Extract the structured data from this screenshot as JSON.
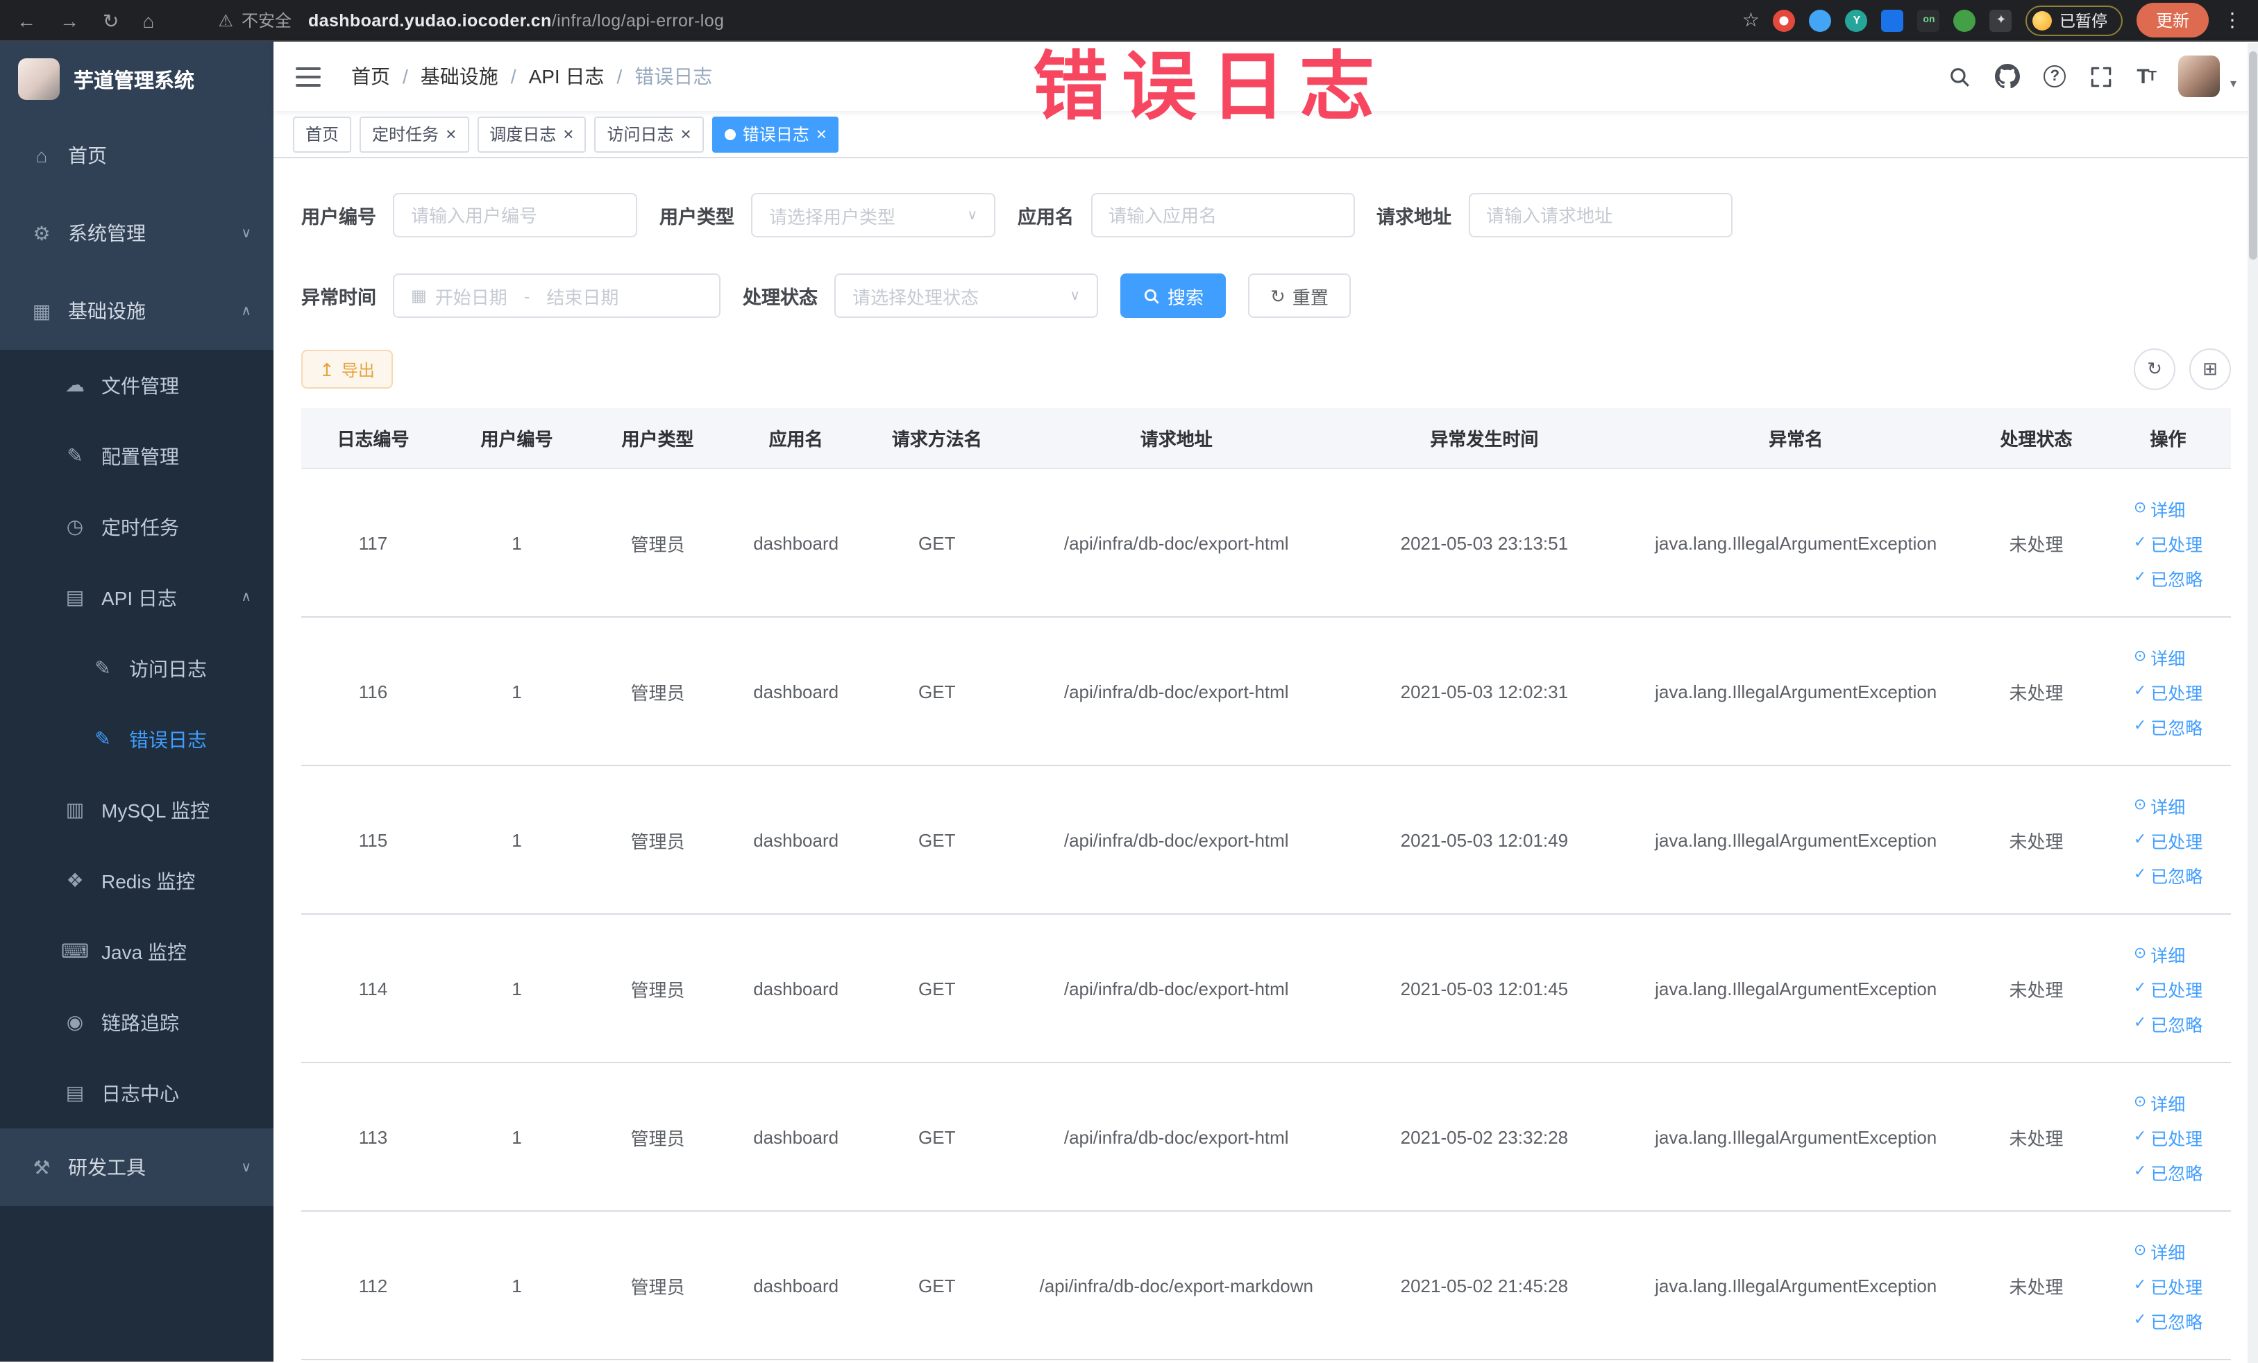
{
  "colors": {
    "accent": "#409eff",
    "sidebar_bg": "#304156",
    "sidebar_submenu_bg": "#1f2d3d",
    "annotation": "#f74760",
    "warning": "#e6a23c"
  },
  "browser": {
    "security_text": "不安全",
    "url_domain": "dashboard.yudao.iocoder.cn",
    "url_path": "/infra/log/api-error-log",
    "paused_badge": "已暂停",
    "update_button": "更新"
  },
  "annotation": {
    "text": "错误日志"
  },
  "sidebar": {
    "logo_title": "芋道管理系统",
    "items": [
      {
        "key": "home",
        "label": "首页",
        "icon": "home-icon",
        "glyph": "⌂",
        "level": 1
      },
      {
        "key": "system-management",
        "label": "系统管理",
        "icon": "gear-icon",
        "glyph": "⚙",
        "level": 1,
        "chevron": "down"
      },
      {
        "key": "infrastructure",
        "label": "基础设施",
        "icon": "grid-icon",
        "glyph": "▦",
        "level": 1,
        "chevron": "up"
      },
      {
        "key": "file-management",
        "label": "文件管理",
        "icon": "cloud-icon",
        "glyph": "☁",
        "level": 2
      },
      {
        "key": "config-management",
        "label": "配置管理",
        "icon": "edit-icon",
        "glyph": "✎",
        "level": 2
      },
      {
        "key": "scheduled-tasks",
        "label": "定时任务",
        "icon": "clock-icon",
        "glyph": "◷",
        "level": 2
      },
      {
        "key": "api-log",
        "label": "API 日志",
        "icon": "document-icon",
        "glyph": "▤",
        "level": 2,
        "chevron": "up"
      },
      {
        "key": "access-log",
        "label": "访问日志",
        "icon": "document-edit-icon",
        "glyph": "✎",
        "level": 3
      },
      {
        "key": "error-log",
        "label": "错误日志",
        "icon": "document-edit-icon",
        "glyph": "✎",
        "level": 3,
        "active": true
      },
      {
        "key": "mysql-monitor",
        "label": "MySQL 监控",
        "icon": "database-icon",
        "glyph": "▥",
        "level": 2
      },
      {
        "key": "redis-monitor",
        "label": "Redis 监控",
        "icon": "storage-icon",
        "glyph": "❖",
        "level": 2
      },
      {
        "key": "java-monitor",
        "label": "Java 监控",
        "icon": "monitor-icon",
        "glyph": "⌨",
        "level": 2
      },
      {
        "key": "link-tracing",
        "label": "链路追踪",
        "icon": "eye-icon",
        "glyph": "◉",
        "level": 2
      },
      {
        "key": "log-center",
        "label": "日志中心",
        "icon": "list-icon",
        "glyph": "▤",
        "level": 2
      },
      {
        "key": "dev-tools",
        "label": "研发工具",
        "icon": "tools-icon",
        "glyph": "⚒",
        "level": 1,
        "chevron": "down"
      }
    ]
  },
  "header": {
    "breadcrumb": [
      "首页",
      "基础设施",
      "API 日志",
      "错误日志"
    ]
  },
  "tabs": [
    {
      "label": "首页",
      "closable": false,
      "active": false
    },
    {
      "label": "定时任务",
      "closable": true,
      "active": false
    },
    {
      "label": "调度日志",
      "closable": true,
      "active": false
    },
    {
      "label": "访问日志",
      "closable": true,
      "active": false
    },
    {
      "label": "错误日志",
      "closable": true,
      "active": true
    }
  ],
  "filters": {
    "user_id_label": "用户编号",
    "user_id_placeholder": "请输入用户编号",
    "user_type_label": "用户类型",
    "user_type_placeholder": "请选择用户类型",
    "app_name_label": "应用名",
    "app_name_placeholder": "请输入应用名",
    "request_url_label": "请求地址",
    "request_url_placeholder": "请输入请求地址",
    "exception_time_label": "异常时间",
    "start_date_placeholder": "开始日期",
    "end_date_placeholder": "结束日期",
    "process_status_label": "处理状态",
    "process_status_placeholder": "请选择处理状态",
    "search_button": "搜索",
    "reset_button": "重置"
  },
  "toolbar": {
    "export_label": "导出"
  },
  "table": {
    "columns": [
      "日志编号",
      "用户编号",
      "用户类型",
      "应用名",
      "请求方法名",
      "请求地址",
      "异常发生时间",
      "异常名",
      "处理状态",
      "操作"
    ],
    "action_labels": {
      "detail": "详细",
      "processed": "已处理",
      "ignored": "已忽略"
    },
    "rows": [
      {
        "id": "117",
        "user_id": "1",
        "user_type": "管理员",
        "app": "dashboard",
        "method": "GET",
        "url": "/api/infra/db-doc/export-html",
        "time": "2021-05-03 23:13:51",
        "exception": "java.lang.IllegalArgumentException",
        "status": "未处理"
      },
      {
        "id": "116",
        "user_id": "1",
        "user_type": "管理员",
        "app": "dashboard",
        "method": "GET",
        "url": "/api/infra/db-doc/export-html",
        "time": "2021-05-03 12:02:31",
        "exception": "java.lang.IllegalArgumentException",
        "status": "未处理"
      },
      {
        "id": "115",
        "user_id": "1",
        "user_type": "管理员",
        "app": "dashboard",
        "method": "GET",
        "url": "/api/infra/db-doc/export-html",
        "time": "2021-05-03 12:01:49",
        "exception": "java.lang.IllegalArgumentException",
        "status": "未处理"
      },
      {
        "id": "114",
        "user_id": "1",
        "user_type": "管理员",
        "app": "dashboard",
        "method": "GET",
        "url": "/api/infra/db-doc/export-html",
        "time": "2021-05-03 12:01:45",
        "exception": "java.lang.IllegalArgumentException",
        "status": "未处理"
      },
      {
        "id": "113",
        "user_id": "1",
        "user_type": "管理员",
        "app": "dashboard",
        "method": "GET",
        "url": "/api/infra/db-doc/export-html",
        "time": "2021-05-02 23:32:28",
        "exception": "java.lang.IllegalArgumentException",
        "status": "未处理"
      },
      {
        "id": "112",
        "user_id": "1",
        "user_type": "管理员",
        "app": "dashboard",
        "method": "GET",
        "url": "/api/infra/db-doc/export-markdown",
        "time": "2021-05-02 21:45:28",
        "exception": "java.lang.IllegalArgumentException",
        "status": "未处理"
      }
    ]
  }
}
